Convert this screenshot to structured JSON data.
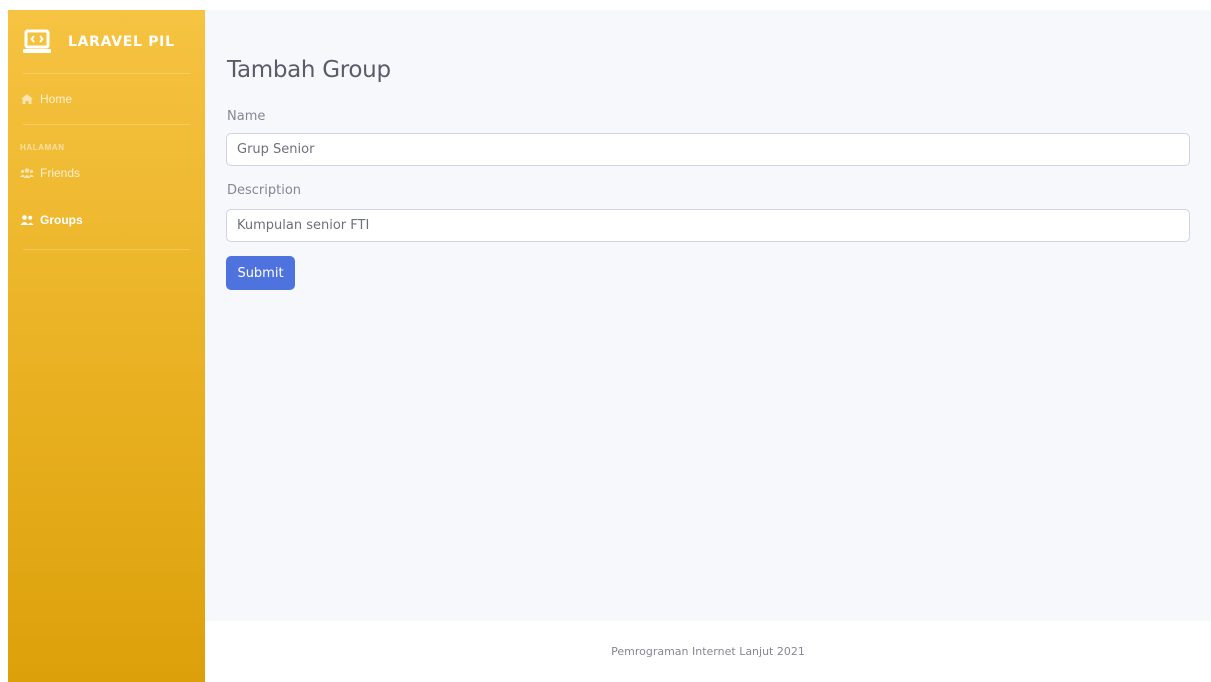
{
  "sidebar": {
    "brand": {
      "title": "LARAVEL PIL",
      "icon": "laptop-code-icon"
    },
    "items": [
      {
        "label": "Home",
        "icon": "home-icon"
      },
      {
        "label": "Friends",
        "icon": "users-icon"
      },
      {
        "label": "Groups",
        "icon": "user-friends-icon"
      }
    ],
    "heading": "HALAMAN"
  },
  "main": {
    "title": "Tambah Group",
    "form": {
      "name_label": "Name",
      "name_value": "Grup Senior",
      "description_label": "Description",
      "description_value": "Kumpulan senior FTI",
      "submit_label": "Submit"
    }
  },
  "footer": {
    "text": "Pemrograman Internet Lanjut 2021"
  },
  "colors": {
    "sidebar_top": "#f6c342",
    "sidebar_bottom": "#dca00a",
    "primary": "#4e73df",
    "content_bg": "#f7f8fc"
  }
}
